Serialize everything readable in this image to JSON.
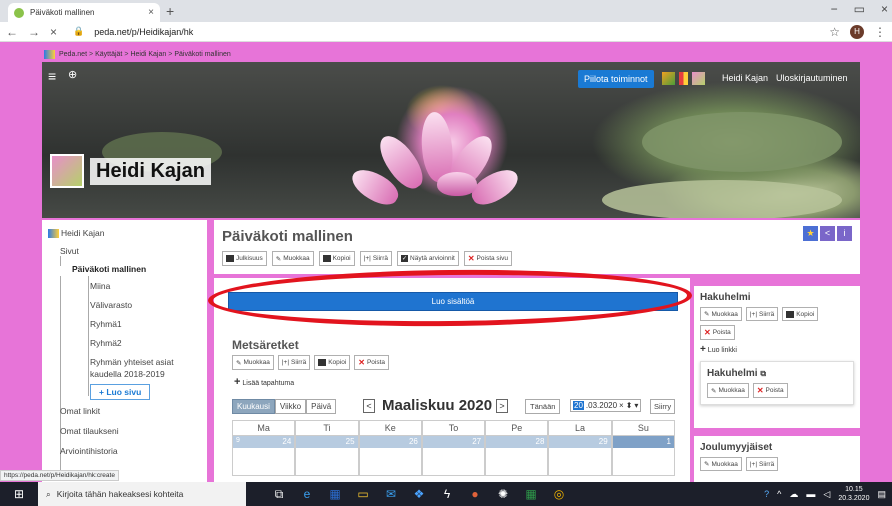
{
  "browser": {
    "tab_title": "Päiväkoti mallinen",
    "tab_close": "×",
    "new_tab": "+",
    "back": "←",
    "forward": "→",
    "reload": "×",
    "url": "peda.net/p/Heidikajan/hk",
    "bookmark_star": "☆",
    "profile_initial": "H",
    "menu": "⋮",
    "minimize": "−",
    "maximize": "▭",
    "close": "×"
  },
  "breadcrumb": {
    "items": [
      "Peda.net",
      "Käyttäjät",
      "Heidi Kajan",
      "Päiväkoti mallinen"
    ],
    "separator": ">"
  },
  "banner": {
    "menu_icon": "≡",
    "search_icon": "🔍",
    "toggle_label": "Piilota toiminnot",
    "user_name": "Heidi Kajan",
    "logout": "Uloskirjautuminen",
    "site_name": "Heidi Kajan"
  },
  "leftnav": {
    "root": "Heidi Kajan",
    "sivut": "Sivut",
    "current": "Päiväkoti mallinen",
    "children": [
      "Miina",
      "Välivarasto",
      "Ryhmä1",
      "Ryhmä2",
      "Ryhmän yhteiset asiat",
      "kaudella 2018-2019"
    ],
    "luo_sivu": "+ Luo sivu",
    "omat_linkit": "Omat linkit",
    "omat_tilaukseni": "Omat tilaukseni",
    "arviointihistoria": "Arviointihistoria"
  },
  "main": {
    "title": "Päiväkoti mallinen",
    "toolbar": [
      "Julkisuus",
      "Muokkaa",
      "Kopioi",
      "Siirrä",
      "Näytä arvioinnit",
      "Poista sivu"
    ],
    "head_icons": [
      "★",
      "<",
      "i"
    ],
    "create_content": "Luo sisältöä"
  },
  "calendar_section": {
    "title": "Metsäretket",
    "buttons": [
      "Muokkaa",
      "Siirrä",
      "Kopioi",
      "Poista"
    ],
    "add_event": "Lisää tapahtuma",
    "views": [
      "Kuukausi",
      "Viikko",
      "Päivä"
    ],
    "prev": "<",
    "next": ">",
    "month_title": "Maaliskuu 2020",
    "today": "Tänään",
    "date_day": "20",
    "date_rest": ".03.2020",
    "date_clear": "×",
    "date_spin": "⬍",
    "date_drop": "▾",
    "go": "Siirry",
    "weekdays": [
      "Ma",
      "Ti",
      "Ke",
      "To",
      "Pe",
      "La",
      "Su"
    ],
    "week_no": "9",
    "days": [
      "24",
      "25",
      "26",
      "27",
      "28",
      "29",
      "1"
    ]
  },
  "right": {
    "hakuhelmi_title": "Hakuhelmi",
    "hakuhelmi_buttons": [
      "Muokkaa",
      "Siirrä",
      "Kopioi",
      "Poista"
    ],
    "luo_linkki": "Luo linkki",
    "sub_title": "Hakuhelmi",
    "sub_buttons": [
      "Muokkaa",
      "Poista"
    ],
    "joulu_title": "Joulumyyjäiset",
    "joulu_buttons": [
      "Muokkaa",
      "Siirrä"
    ]
  },
  "status_url": "https://peda.net/p/Heidikajan/hk:create",
  "taskbar": {
    "start": "⊞",
    "search_placeholder": "Kirjoita tähän hakeaksesi kohteita",
    "time": "10.15",
    "date": "20.3.2020"
  },
  "colors": {
    "page_bg": "#e774d8",
    "accent": "#1f74d0",
    "ring": "#e2141e"
  }
}
